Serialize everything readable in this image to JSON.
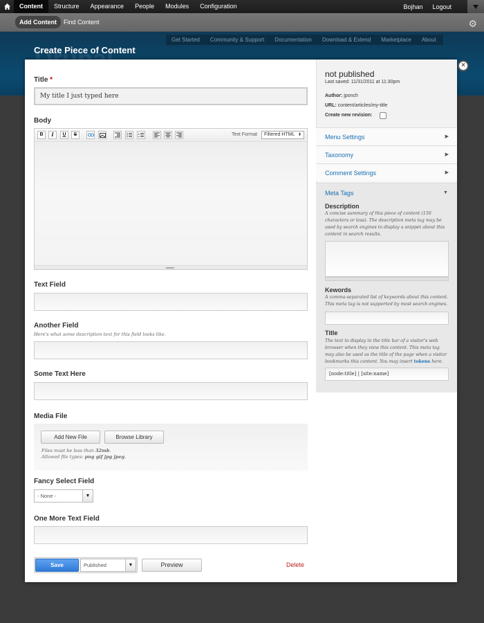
{
  "toolbar": {
    "nav": [
      "Content",
      "Structure",
      "Appearance",
      "People",
      "Modules",
      "Configuration"
    ],
    "user": "Bojhan",
    "logout": "Logout"
  },
  "shortcuts": {
    "add_content": "Add Content",
    "find_content": "Find Content"
  },
  "header": {
    "secondary_links": [
      "Get Started",
      "Community & Support",
      "Documentation",
      "Download & Extend",
      "Marketplace",
      "About"
    ],
    "page_title": "Create Piece of Content",
    "site_name_watermark": "Drupal"
  },
  "form": {
    "title_label": "Title",
    "required_marker": "*",
    "title_value": "My title I just typed here",
    "body_label": "Body",
    "text_format_label": "Text Format",
    "text_format_value": "Filtered HTML",
    "editor_buttons": {
      "bold": "B",
      "italic": "I",
      "underline": "U",
      "strike": "S"
    },
    "text_field_label": "Text Field",
    "another_field_label": "Another Field",
    "another_field_desc": "Here's what some description text for this field looks like.",
    "some_text_label": "Some Text Here",
    "media_label": "Media File",
    "add_new_file": "Add New File",
    "browse_library": "Browse Library",
    "media_note_1": "Files must be less than ",
    "media_note_size": "32mb",
    "media_note_1_end": ".",
    "media_note_2": "Allowed file types: ",
    "media_note_types": "png gif jpg jpeg",
    "media_note_2_end": ".",
    "fancy_select_label": "Fancy Select Field",
    "fancy_select_value": "- None -",
    "one_more_label": "One More Text Field",
    "save": "Save",
    "status_select": "Published",
    "preview": "Preview",
    "delete": "Delete"
  },
  "sidebar": {
    "status": "not published",
    "last_saved": "Last saved: 11/31/2011 at 11:30pm",
    "author_label": "Author:",
    "author": "jponch",
    "url_label": "URL:",
    "url": "content/articles/my-title",
    "revision_label": "Create new revision:",
    "sections": [
      "Menu Settings",
      "Taxonomy",
      "Comment Settings"
    ],
    "meta_tags_title": "Meta Tags",
    "description_label": "Description",
    "description_help": "A concise summary of this piece of content (150 characters or less). The description meta tag may be used by search engines to display a snippet about this content in search results.",
    "keywords_label": "Kewords",
    "keywords_help": "A comma-separated list of keywords about this content. This meta tag is not supported by most search engines.",
    "title_label": "Title",
    "title_help_1": "The text to display in the title bar of a visitor's web browser when they view this content. This meta tag may also be used as the title of the page when a visitor bookmarks this content. You may insert ",
    "title_help_link": "tokens",
    "title_help_2": " here.",
    "title_value": "[node:title] | [site:name]"
  },
  "colors": {
    "link_blue": "#1a6fb2",
    "header_blue": "#0b4a70",
    "save_blue": "#2f7ad8",
    "delete_red": "#b22222",
    "required_red": "#cc0000"
  }
}
